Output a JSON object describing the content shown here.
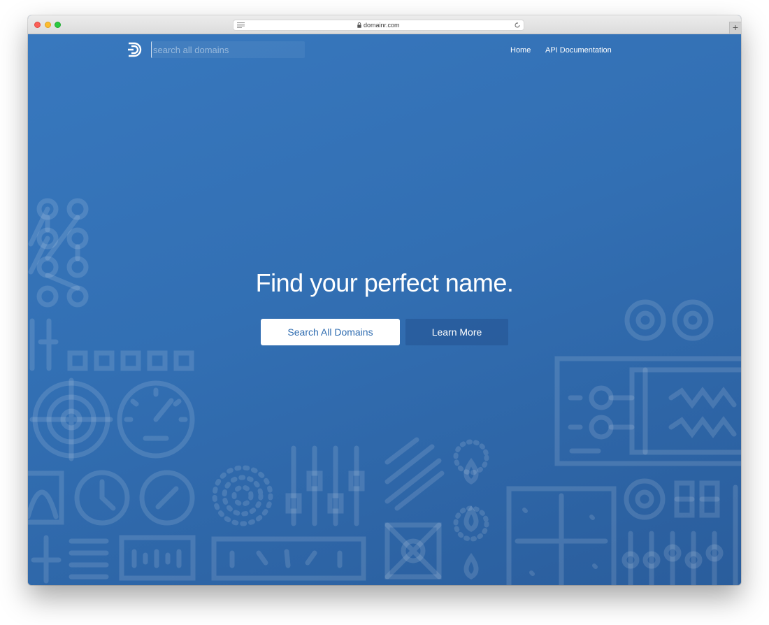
{
  "browser": {
    "url": "domainr.com",
    "new_tab_label": "+"
  },
  "header": {
    "search": {
      "placeholder": "search all domains",
      "value": ""
    },
    "nav": [
      {
        "label": "Home"
      },
      {
        "label": "API Documentation"
      }
    ]
  },
  "hero": {
    "title": "Find your perfect name.",
    "primary_button": "Search All Domains",
    "secondary_button": "Learn More"
  },
  "colors": {
    "brand_blue": "#2f6cb0",
    "button_text": "#2f6cb0"
  }
}
